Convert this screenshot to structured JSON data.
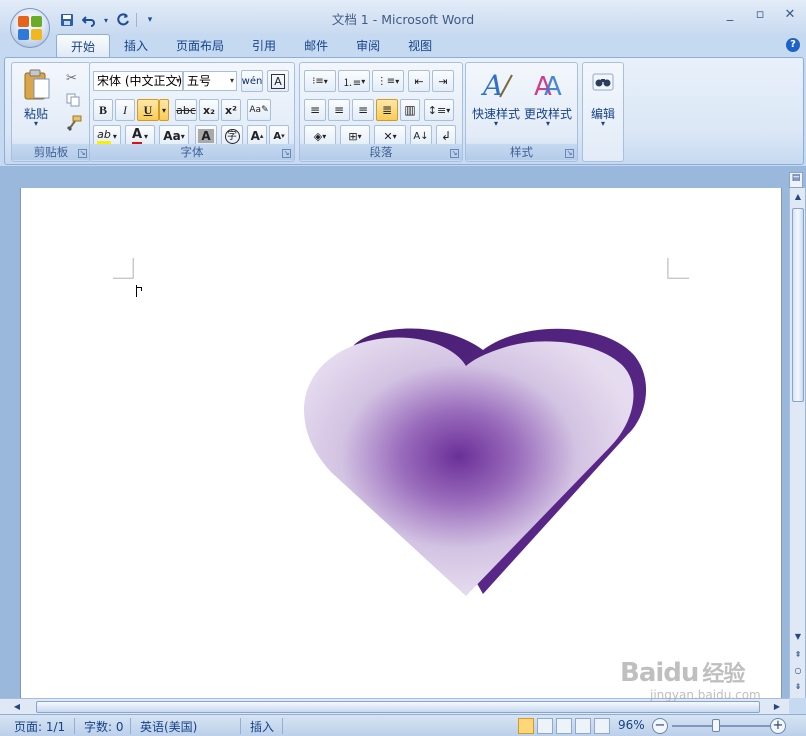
{
  "window": {
    "title": "文档 1 - Microsoft Word",
    "controls": [
      "minimize",
      "maximize",
      "close"
    ]
  },
  "qat": {
    "save_icon": "save-icon",
    "undo_icon": "undo-icon",
    "redo_icon": "redo-icon",
    "customize_icon": "customize-icon"
  },
  "tabs": [
    {
      "label": "开始",
      "active": true
    },
    {
      "label": "插入"
    },
    {
      "label": "页面布局"
    },
    {
      "label": "引用"
    },
    {
      "label": "邮件"
    },
    {
      "label": "审阅"
    },
    {
      "label": "视图"
    }
  ],
  "ribbon": {
    "clipboard": {
      "label": "剪贴板",
      "paste": "粘贴"
    },
    "font": {
      "label": "字体",
      "font_name": "宋体 (中文正文)",
      "font_size": "五号"
    },
    "paragraph": {
      "label": "段落"
    },
    "styles": {
      "label": "样式",
      "quick_styles": "快速样式",
      "change_styles": "更改样式"
    },
    "editing": {
      "label": "编辑"
    }
  },
  "document": {
    "shape": "heart",
    "heart_colors": {
      "edge": "#4e2478",
      "light": "#e0d4ea",
      "center": "#6a2f98"
    }
  },
  "statusbar": {
    "page": "页面: 1/1",
    "words": "字数: 0",
    "language": "英语(美国)",
    "mode": "插入",
    "zoom": "96%",
    "zoom_value": 96
  },
  "watermark": {
    "brand": "Baidu",
    "cn": "经验",
    "url": "jingyan.baidu.com"
  }
}
